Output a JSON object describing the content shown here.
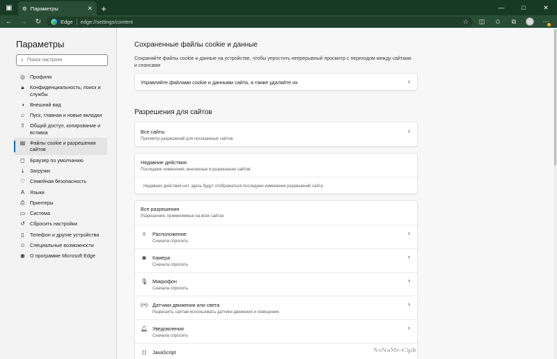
{
  "window": {
    "tab_title": "Параметры",
    "minimize_glyph": "—",
    "maximize_glyph": "□",
    "close_glyph": "✕"
  },
  "addressbar": {
    "site_label": "Edge",
    "url": "edge://settings/content"
  },
  "sidebar": {
    "title": "Параметры",
    "search_placeholder": "Поиск настроек",
    "items": [
      {
        "label": "Профили",
        "icon": "profile-icon",
        "active": false
      },
      {
        "label": "Конфиденциальность, поиск и службы",
        "icon": "lock-icon",
        "active": false
      },
      {
        "label": "Внешний вид",
        "icon": "appearance-icon",
        "active": false
      },
      {
        "label": "Пуск, главная и новые вкладки",
        "icon": "home-icon",
        "active": false
      },
      {
        "label": "Общий доступ, копирование и вставка",
        "icon": "share-icon",
        "active": false
      },
      {
        "label": "Файлы cookie и разрешения сайтов",
        "icon": "cookie-icon",
        "active": true
      },
      {
        "label": "Браузер по умолчанию",
        "icon": "browser-icon",
        "active": false
      },
      {
        "label": "Загрузки",
        "icon": "download-icon",
        "active": false
      },
      {
        "label": "Семейная безопасность",
        "icon": "family-icon",
        "active": false
      },
      {
        "label": "Языки",
        "icon": "language-icon",
        "active": false
      },
      {
        "label": "Принтеры",
        "icon": "printer-icon",
        "active": false
      },
      {
        "label": "Система",
        "icon": "system-icon",
        "active": false
      },
      {
        "label": "Сбросить настройки",
        "icon": "reset-icon",
        "active": false
      },
      {
        "label": "Телефон и другие устройства",
        "icon": "phone-icon",
        "active": false
      },
      {
        "label": "Специальные возможности",
        "icon": "accessibility-icon",
        "active": false
      },
      {
        "label": "О программе Microsoft Edge",
        "icon": "edge-icon",
        "active": false
      }
    ]
  },
  "cookies": {
    "heading": "Сохраненные файлы cookie и данные",
    "description": "Сохраняйте файлы cookie и данные на устройстве, чтобы упростить непрерывный просмотр с переходом между сайтами и сеансами",
    "manage_label": "Управляйте файлами cookie и данными сайта, а также удаляйте их"
  },
  "permissions": {
    "heading": "Разрешения для сайтов",
    "all_sites": {
      "title": "Все сайты",
      "subtitle": "Просмотр разрешений для посещенных сайтов"
    },
    "recent": {
      "title": "Недавние действия",
      "subtitle": "Последние изменения, внесенные в разрешения сайтов",
      "empty": "Недавних действий нет. здесь будут отображаться последние изменения разрешений сайта"
    },
    "all_permissions": {
      "title": "Все разрешения",
      "subtitle": "Разрешения, применяемые на всех сайтах"
    },
    "items": [
      {
        "title": "Расположение",
        "subtitle": "Сначала спросить",
        "icon": "location-icon"
      },
      {
        "title": "Камера",
        "subtitle": "Сначала спросить",
        "icon": "camera-icon"
      },
      {
        "title": "Микрофон",
        "subtitle": "Сначала спросить",
        "icon": "microphone-icon"
      },
      {
        "title": "Датчики движения или света",
        "subtitle": "Разрешить сайтам использовать датчики движения и освещения",
        "icon": "sensor-icon"
      },
      {
        "title": "Уведомления",
        "subtitle": "Сначала спросить",
        "icon": "bell-icon"
      },
      {
        "title": "JavaScript",
        "subtitle": "",
        "icon": "code-icon"
      }
    ]
  },
  "watermark": "NoNaMe-Club",
  "colors": {
    "titlebar": "#183a25",
    "toolbar": "#2a4d35",
    "accent": "#0f6cbd"
  }
}
